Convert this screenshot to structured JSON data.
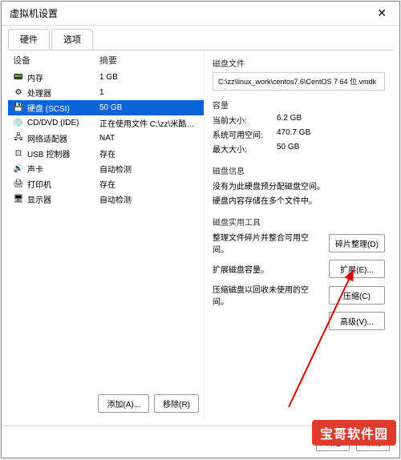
{
  "titlebar": {
    "title": "虚拟机设置"
  },
  "tabs": {
    "hardware": "硬件",
    "options": "选项"
  },
  "deviceHeader": {
    "col1": "设备",
    "col2": "摘要"
  },
  "devices": [
    {
      "icon": "📟",
      "name": "内存",
      "summary": "1 GB"
    },
    {
      "icon": "⚙",
      "name": "处理器",
      "summary": "1"
    },
    {
      "icon": "💾",
      "name": "硬盘 (SCSI)",
      "summary": "50 GB"
    },
    {
      "icon": "💿",
      "name": "CD/DVD (IDE)",
      "summary": "正在使用文件 C:\\zz\\米酷工作..."
    },
    {
      "icon": "🖧",
      "name": "网络适配器",
      "summary": "NAT"
    },
    {
      "icon": "⊡",
      "name": "USB 控制器",
      "summary": "存在"
    },
    {
      "icon": "🔊",
      "name": "声卡",
      "summary": "自动检测"
    },
    {
      "icon": "🖨",
      "name": "打印机",
      "summary": "存在"
    },
    {
      "icon": "🖥",
      "name": "显示器",
      "summary": "自动检测"
    }
  ],
  "leftButtons": {
    "add": "添加(A)...",
    "remove": "移除(R)"
  },
  "right": {
    "diskFileLabel": "磁盘文件",
    "diskFilePath": "C:\\zz\\linux_work\\centos7.6\\CentOS 7 64 位.vmdk",
    "capacityLabel": "容量",
    "currentSize": {
      "label": "当前大小:",
      "value": "6.2 GB"
    },
    "freeSpace": {
      "label": "系统可用空间:",
      "value": "470.7 GB"
    },
    "maxSize": {
      "label": "最大大小:",
      "value": "50 GB"
    },
    "diskInfoLabel": "磁盘信息",
    "diskInfoLine1": "没有为此硬盘预分配磁盘空间。",
    "diskInfoLine2": "硬盘内容存储在多个文件中。",
    "diskUtilLabel": "磁盘实用工具",
    "defragText": "整理文件碎片并整合可用空间。",
    "defragBtn": "碎片整理(D)",
    "expandText": "扩展磁盘容量。",
    "expandBtn": "扩展(E)...",
    "compactText": "压缩磁盘以回收未使用的空间。",
    "compactBtn": "压缩(C)",
    "advancedBtn": "高级(V)..."
  },
  "footer": {
    "ok": "确定",
    "cancel": "取消"
  },
  "watermark": "宝哥软件园"
}
